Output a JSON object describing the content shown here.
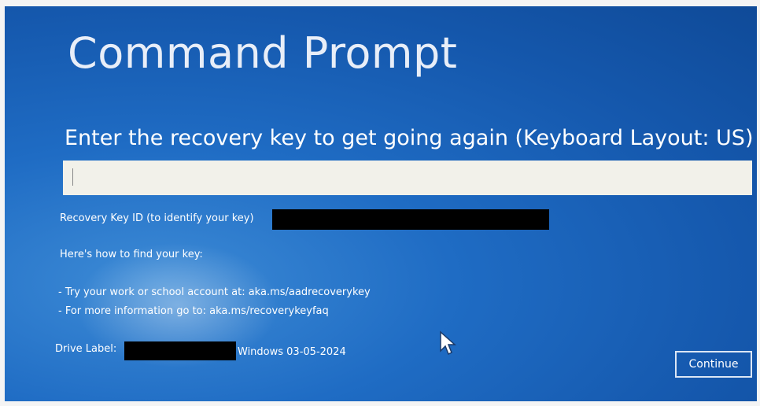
{
  "screen": {
    "title": "Command Prompt",
    "prompt": "Enter the recovery key to get going again (Keyboard Layout: US)"
  },
  "recovery_key_input": {
    "value": "",
    "placeholder": ""
  },
  "key_id": {
    "label": "Recovery Key ID (to identify your key)"
  },
  "help": {
    "heading": "Here's how to find your key:",
    "lines": [
      "- Try your work or school account at: aka.ms/aadrecoverykey",
      "- For more information go to: aka.ms/recoverykeyfaq"
    ]
  },
  "drive": {
    "label": "Drive Label:",
    "value_suffix": "Windows 03-05-2024"
  },
  "actions": {
    "continue_label": "Continue"
  },
  "colors": {
    "background": "#1f6cc4",
    "input": "#f2f1ea",
    "text": "#ffffff",
    "redaction": "#000000"
  },
  "icons": {
    "pointer": "mouse-pointer-icon"
  }
}
